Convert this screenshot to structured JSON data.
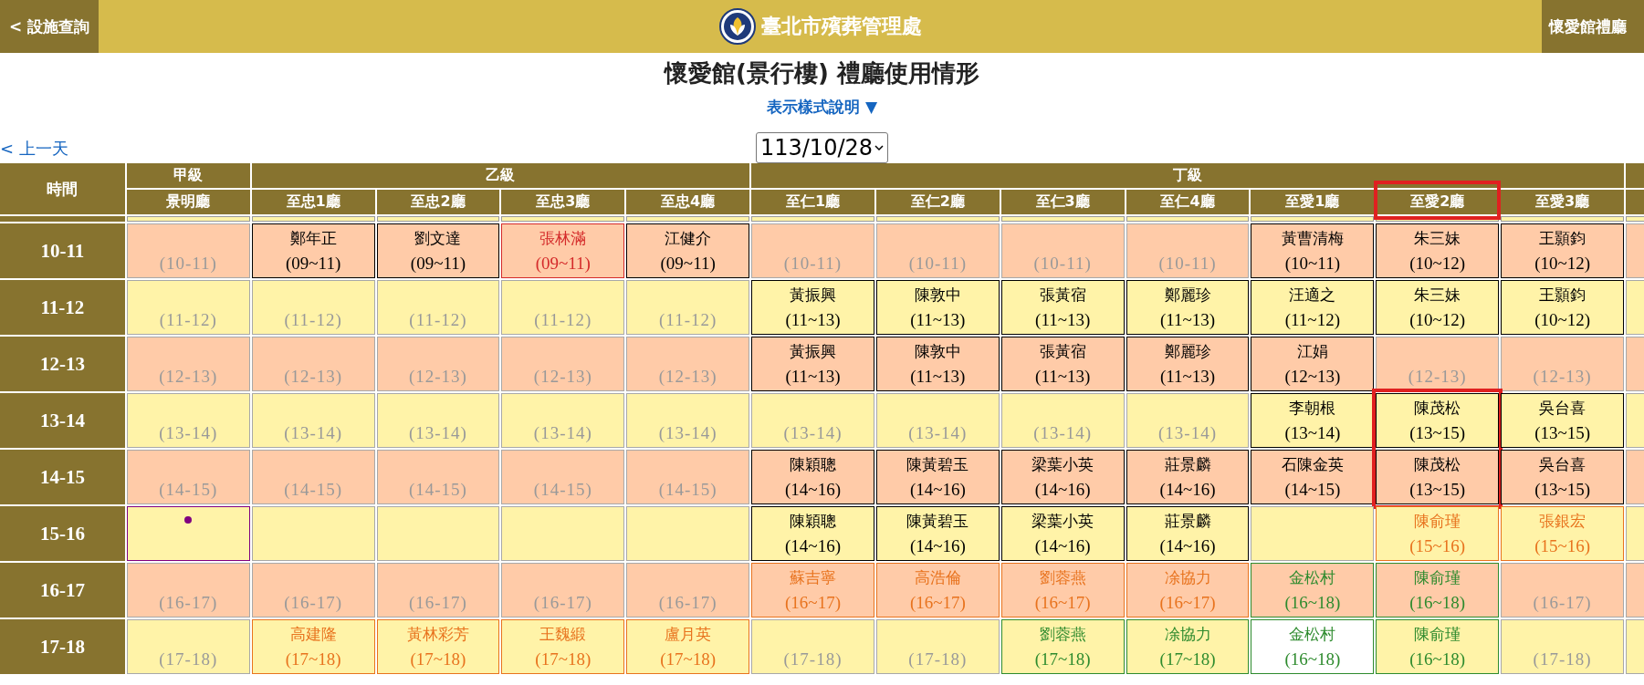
{
  "top_bar": {
    "back_link": "< 設施查詢",
    "org_name": "臺北市殯葬管理處",
    "right_link": "懷愛館禮廳"
  },
  "title": "懷愛館(景行樓) 禮廳使用情形",
  "legend_link": "表示樣式說明 ▼",
  "prev_day": "< 上一天",
  "date_select": "113/10/28",
  "table": {
    "time_heading": "時間",
    "groups": [
      {
        "label": "甲級",
        "columns": [
          {
            "label": "景明廳",
            "highlighted": false
          }
        ]
      },
      {
        "label": "乙級",
        "columns": [
          {
            "label": "至忠1廳",
            "highlighted": false
          },
          {
            "label": "至忠2廳",
            "highlighted": false
          },
          {
            "label": "至忠3廳",
            "highlighted": false
          },
          {
            "label": "至忠4廳",
            "highlighted": false
          }
        ]
      },
      {
        "label": "丁級",
        "columns": [
          {
            "label": "至仁1廳",
            "highlighted": false
          },
          {
            "label": "至仁2廳",
            "highlighted": false
          },
          {
            "label": "至仁3廳",
            "highlighted": false
          },
          {
            "label": "至仁4廳",
            "highlighted": false
          },
          {
            "label": "至愛1廳",
            "highlighted": false
          },
          {
            "label": "至愛2廳",
            "highlighted": true
          },
          {
            "label": "至愛3廳",
            "highlighted": false
          }
        ]
      }
    ],
    "rows": [
      {
        "time": "10-11",
        "cells": [
          {
            "kind": "empty",
            "slot": "(10-11)"
          },
          {
            "kind": "booked",
            "name": "鄭年正",
            "range": "(09~11)",
            "color": "#000000"
          },
          {
            "kind": "booked",
            "name": "劉文達",
            "range": "(09~11)",
            "color": "#000000"
          },
          {
            "kind": "booked",
            "name": "張林滿",
            "range": "(09~11)",
            "color": "#d42a2a"
          },
          {
            "kind": "booked",
            "name": "江健介",
            "range": "(09~11)",
            "color": "#000000"
          },
          {
            "kind": "empty",
            "slot": "(10-11)"
          },
          {
            "kind": "empty",
            "slot": "(10-11)"
          },
          {
            "kind": "empty",
            "slot": "(10-11)"
          },
          {
            "kind": "empty",
            "slot": "(10-11)"
          },
          {
            "kind": "booked",
            "name": "黃曹清梅",
            "range": "(10~11)",
            "color": "#000000"
          },
          {
            "kind": "booked",
            "name": "朱三妹",
            "range": "(10~12)",
            "color": "#000000"
          },
          {
            "kind": "booked",
            "name": "王顥鈞",
            "range": "(10~12)",
            "color": "#000000"
          }
        ]
      },
      {
        "time": "11-12",
        "cells": [
          {
            "kind": "empty",
            "slot": "(11-12)"
          },
          {
            "kind": "empty",
            "slot": "(11-12)"
          },
          {
            "kind": "empty",
            "slot": "(11-12)"
          },
          {
            "kind": "empty",
            "slot": "(11-12)"
          },
          {
            "kind": "empty",
            "slot": "(11-12)"
          },
          {
            "kind": "booked",
            "name": "黃振興",
            "range": "(11~13)",
            "color": "#000000"
          },
          {
            "kind": "booked",
            "name": "陳敦中",
            "range": "(11~13)",
            "color": "#000000"
          },
          {
            "kind": "booked",
            "name": "張黃宿",
            "range": "(11~13)",
            "color": "#000000"
          },
          {
            "kind": "booked",
            "name": "鄭麗珍",
            "range": "(11~13)",
            "color": "#000000"
          },
          {
            "kind": "booked",
            "name": "汪適之",
            "range": "(11~12)",
            "color": "#000000"
          },
          {
            "kind": "booked",
            "name": "朱三妹",
            "range": "(10~12)",
            "color": "#000000"
          },
          {
            "kind": "booked",
            "name": "王顥鈞",
            "range": "(10~12)",
            "color": "#000000"
          }
        ]
      },
      {
        "time": "12-13",
        "cells": [
          {
            "kind": "empty",
            "slot": "(12-13)"
          },
          {
            "kind": "empty",
            "slot": "(12-13)"
          },
          {
            "kind": "empty",
            "slot": "(12-13)"
          },
          {
            "kind": "empty",
            "slot": "(12-13)"
          },
          {
            "kind": "empty",
            "slot": "(12-13)"
          },
          {
            "kind": "booked",
            "name": "黃振興",
            "range": "(11~13)",
            "color": "#000000"
          },
          {
            "kind": "booked",
            "name": "陳敦中",
            "range": "(11~13)",
            "color": "#000000"
          },
          {
            "kind": "booked",
            "name": "張黃宿",
            "range": "(11~13)",
            "color": "#000000"
          },
          {
            "kind": "booked",
            "name": "鄭麗珍",
            "range": "(11~13)",
            "color": "#000000"
          },
          {
            "kind": "booked",
            "name": "江娟",
            "range": "(12~13)",
            "color": "#000000"
          },
          {
            "kind": "empty",
            "slot": "(12-13)"
          },
          {
            "kind": "empty",
            "slot": "(12-13)"
          }
        ]
      },
      {
        "time": "13-14",
        "cells": [
          {
            "kind": "empty",
            "slot": "(13-14)"
          },
          {
            "kind": "empty",
            "slot": "(13-14)"
          },
          {
            "kind": "empty",
            "slot": "(13-14)"
          },
          {
            "kind": "empty",
            "slot": "(13-14)"
          },
          {
            "kind": "empty",
            "slot": "(13-14)"
          },
          {
            "kind": "empty",
            "slot": "(13-14)"
          },
          {
            "kind": "empty",
            "slot": "(13-14)"
          },
          {
            "kind": "empty",
            "slot": "(13-14)"
          },
          {
            "kind": "empty",
            "slot": "(13-14)"
          },
          {
            "kind": "booked",
            "name": "李朝根",
            "range": "(13~14)",
            "color": "#000000"
          },
          {
            "kind": "booked",
            "name": "陳茂松",
            "range": "(13~15)",
            "color": "#000000",
            "highlighted": true
          },
          {
            "kind": "booked",
            "name": "吳台喜",
            "range": "(13~15)",
            "color": "#000000"
          }
        ]
      },
      {
        "time": "14-15",
        "cells": [
          {
            "kind": "empty",
            "slot": "(14-15)"
          },
          {
            "kind": "empty",
            "slot": "(14-15)"
          },
          {
            "kind": "empty",
            "slot": "(14-15)"
          },
          {
            "kind": "empty",
            "slot": "(14-15)"
          },
          {
            "kind": "empty",
            "slot": "(14-15)"
          },
          {
            "kind": "booked",
            "name": "陳穎聰",
            "range": "(14~16)",
            "color": "#000000"
          },
          {
            "kind": "booked",
            "name": "陳黃碧玉",
            "range": "(14~16)",
            "color": "#000000"
          },
          {
            "kind": "booked",
            "name": "梁葉小英",
            "range": "(14~16)",
            "color": "#000000"
          },
          {
            "kind": "booked",
            "name": "莊景麟",
            "range": "(14~16)",
            "color": "#000000"
          },
          {
            "kind": "booked",
            "name": "石陳金英",
            "range": "(14~15)",
            "color": "#000000"
          },
          {
            "kind": "booked",
            "name": "陳茂松",
            "range": "(13~15)",
            "color": "#000000",
            "highlighted": true
          },
          {
            "kind": "booked",
            "name": "吳台喜",
            "range": "(13~15)",
            "color": "#000000"
          }
        ]
      },
      {
        "time": "15-16",
        "cells": [
          {
            "kind": "dot",
            "color": "#800080"
          },
          {
            "kind": "blank"
          },
          {
            "kind": "blank"
          },
          {
            "kind": "blank"
          },
          {
            "kind": "blank"
          },
          {
            "kind": "booked",
            "name": "陳穎聰",
            "range": "(14~16)",
            "color": "#000000"
          },
          {
            "kind": "booked",
            "name": "陳黃碧玉",
            "range": "(14~16)",
            "color": "#000000"
          },
          {
            "kind": "booked",
            "name": "梁葉小英",
            "range": "(14~16)",
            "color": "#000000"
          },
          {
            "kind": "booked",
            "name": "莊景麟",
            "range": "(14~16)",
            "color": "#000000"
          },
          {
            "kind": "blank"
          },
          {
            "kind": "booked",
            "name": "陳俞瑾",
            "range": "(15~16)",
            "color": "#e8731e"
          },
          {
            "kind": "booked",
            "name": "張銀宏",
            "range": "(15~16)",
            "color": "#e8731e"
          }
        ]
      },
      {
        "time": "16-17",
        "cells": [
          {
            "kind": "empty",
            "slot": "(16-17)"
          },
          {
            "kind": "empty",
            "slot": "(16-17)"
          },
          {
            "kind": "empty",
            "slot": "(16-17)"
          },
          {
            "kind": "empty",
            "slot": "(16-17)"
          },
          {
            "kind": "empty",
            "slot": "(16-17)"
          },
          {
            "kind": "booked",
            "name": "蘇吉寧",
            "range": "(16~17)",
            "color": "#e8731e"
          },
          {
            "kind": "booked",
            "name": "高浩倫",
            "range": "(16~17)",
            "color": "#e8731e"
          },
          {
            "kind": "booked",
            "name": "劉蓉燕",
            "range": "(16~17)",
            "color": "#e8731e"
          },
          {
            "kind": "booked",
            "name": "凃協力",
            "range": "(16~17)",
            "color": "#e8731e"
          },
          {
            "kind": "booked",
            "name": "金松村",
            "range": "(16~18)",
            "color": "#2e8b2e"
          },
          {
            "kind": "booked",
            "name": "陳俞瑾",
            "range": "(16~18)",
            "color": "#2e8b2e"
          },
          {
            "kind": "empty",
            "slot": "(16-17)"
          }
        ]
      },
      {
        "time": "17-18",
        "cells": [
          {
            "kind": "empty",
            "slot": "(17-18)"
          },
          {
            "kind": "booked",
            "name": "高建隆",
            "range": "(17~18)",
            "color": "#e8731e"
          },
          {
            "kind": "booked",
            "name": "黃林彩芳",
            "range": "(17~18)",
            "color": "#e8731e"
          },
          {
            "kind": "booked",
            "name": "王魏緞",
            "range": "(17~18)",
            "color": "#e8731e"
          },
          {
            "kind": "booked",
            "name": "盧月英",
            "range": "(17~18)",
            "color": "#e8731e"
          },
          {
            "kind": "empty",
            "slot": "(17-18)"
          },
          {
            "kind": "empty",
            "slot": "(17-18)"
          },
          {
            "kind": "booked",
            "name": "劉蓉燕",
            "range": "(17~18)",
            "color": "#2e8b2e"
          },
          {
            "kind": "booked",
            "name": "凃協力",
            "range": "(17~18)",
            "color": "#2e8b2e"
          },
          {
            "kind": "booked",
            "name": "金松村",
            "range": "(16~18)",
            "color": "#2e8b2e",
            "white": true
          },
          {
            "kind": "booked",
            "name": "陳俞瑾",
            "range": "(16~18)",
            "color": "#2e8b2e"
          },
          {
            "kind": "empty",
            "slot": "(17-18)"
          }
        ]
      }
    ]
  }
}
